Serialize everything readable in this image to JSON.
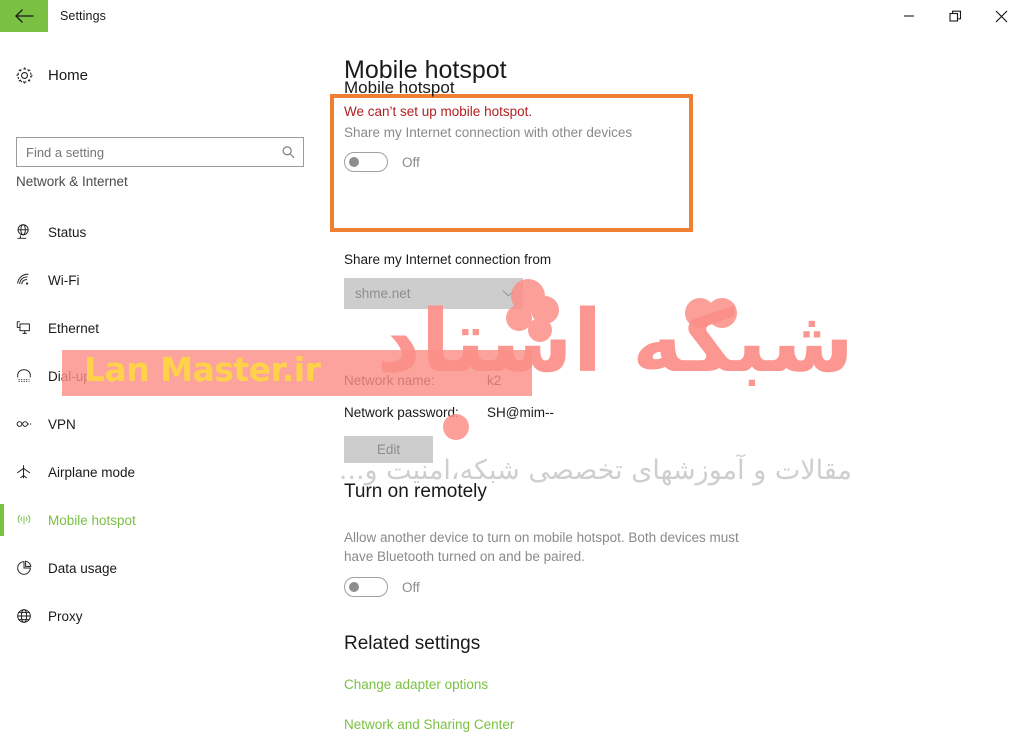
{
  "window": {
    "title": "Settings",
    "back_icon": "back-arrow-icon",
    "minimize_label": "Minimize",
    "restore_label": "Restore",
    "close_label": "Close",
    "accent_green": "#7ac143"
  },
  "sidebar": {
    "home_label": "Home",
    "home_icon": "gear-icon",
    "search": {
      "placeholder": "Find a setting",
      "value": "",
      "icon": "search-icon"
    },
    "category": "Network & Internet",
    "items": [
      {
        "label": "Status",
        "icon": "status-globe-icon",
        "selected": false
      },
      {
        "label": "Wi-Fi",
        "icon": "wifi-icon",
        "selected": false
      },
      {
        "label": "Ethernet",
        "icon": "ethernet-icon",
        "selected": false
      },
      {
        "label": "Dial-up",
        "icon": "dialup-icon",
        "selected": false
      },
      {
        "label": "VPN",
        "icon": "vpn-icon",
        "selected": false
      },
      {
        "label": "Airplane mode",
        "icon": "airplane-icon",
        "selected": false
      },
      {
        "label": "Mobile hotspot",
        "icon": "hotspot-icon",
        "selected": true
      },
      {
        "label": "Data usage",
        "icon": "pie-chart-icon",
        "selected": false
      },
      {
        "label": "Proxy",
        "icon": "globe-icon",
        "selected": false
      }
    ]
  },
  "main": {
    "page_title": "Mobile hotspot",
    "hotspot_card": {
      "title": "Mobile hotspot",
      "error": "We can’t set up mobile hotspot.",
      "subtitle": "Share my Internet connection with other devices",
      "toggle_state": "Off",
      "highlight_color": "#ef8033",
      "error_color": "#b21f1f"
    },
    "share_from": {
      "label": "Share my Internet connection from",
      "selected_option": "shme.net",
      "chevron_icon": "chevron-down-icon"
    },
    "network": {
      "name_label": "Network name:",
      "name_value": "k2",
      "password_label": "Network password:",
      "password_value": "SH@mim--",
      "edit_label": "Edit"
    },
    "remote": {
      "heading": "Turn on remotely",
      "description": "Allow another device to turn on mobile hotspot. Both devices must have Bluetooth turned on and be paired.",
      "toggle_state": "Off"
    },
    "related": {
      "heading": "Related settings",
      "links": [
        "Change adapter options",
        "Network and Sharing Center"
      ]
    }
  },
  "watermark": {
    "logo_text": "Lan Master.ir",
    "big_text": "شبکه استاد",
    "sub_text": "مقالات و آموزشهای تخصصی شبکه،امنیت و..."
  }
}
